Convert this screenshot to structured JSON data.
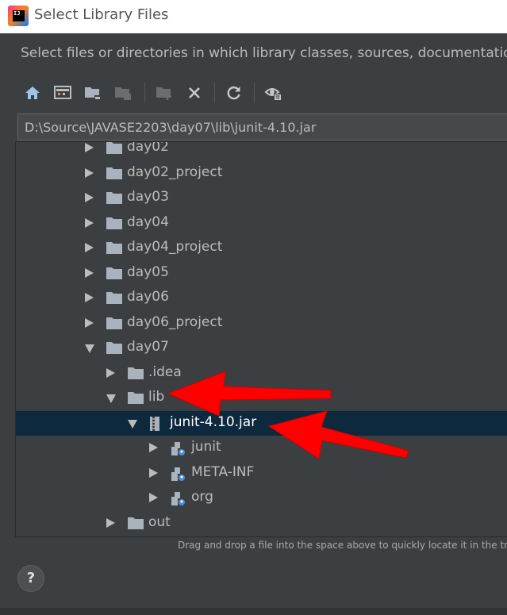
{
  "window": {
    "title": "Select Library Files",
    "logo_text": "IJ"
  },
  "description": "Select files or directories in which library classes, sources, documentation or native libraries are located",
  "toolbar": {
    "buttons": [
      {
        "name": "home-button",
        "icon": "home-icon"
      },
      {
        "name": "desktop-button",
        "icon": "desktop-icon"
      },
      {
        "name": "project-button",
        "icon": "project-folder-icon"
      },
      {
        "name": "module-button",
        "icon": "module-folder-icon"
      },
      {
        "name": "new-folder-button",
        "icon": "new-folder-icon"
      },
      {
        "name": "delete-button",
        "icon": "close-icon"
      },
      {
        "name": "refresh-button",
        "icon": "refresh-icon"
      },
      {
        "name": "show-hidden-button",
        "icon": "show-hidden-icon"
      }
    ]
  },
  "path": "D:\\Source\\JAVASE2203\\day07\\lib\\junit-4.10.jar",
  "tree": {
    "rows": [
      {
        "label": "day02",
        "level": 0,
        "expander": "right",
        "icon": "folder"
      },
      {
        "label": "day02_project",
        "level": 0,
        "expander": "right",
        "icon": "folder"
      },
      {
        "label": "day03",
        "level": 0,
        "expander": "right",
        "icon": "folder"
      },
      {
        "label": "day04",
        "level": 0,
        "expander": "right",
        "icon": "folder"
      },
      {
        "label": "day04_project",
        "level": 0,
        "expander": "right",
        "icon": "folder"
      },
      {
        "label": "day05",
        "level": 0,
        "expander": "right",
        "icon": "folder"
      },
      {
        "label": "day06",
        "level": 0,
        "expander": "right",
        "icon": "folder"
      },
      {
        "label": "day06_project",
        "level": 0,
        "expander": "right",
        "icon": "folder"
      },
      {
        "label": "day07",
        "level": 0,
        "expander": "down",
        "icon": "folder"
      },
      {
        "label": ".idea",
        "level": 1,
        "expander": "right",
        "icon": "folder"
      },
      {
        "label": "lib",
        "level": 1,
        "expander": "down",
        "icon": "folder"
      },
      {
        "label": "junit-4.10.jar",
        "level": 2,
        "expander": "down",
        "icon": "jar",
        "selected": true
      },
      {
        "label": "junit",
        "level": 3,
        "expander": "right",
        "icon": "package"
      },
      {
        "label": "META-INF",
        "level": 3,
        "expander": "right",
        "icon": "package"
      },
      {
        "label": "org",
        "level": 3,
        "expander": "right",
        "icon": "package"
      },
      {
        "label": "out",
        "level": 1,
        "expander": "right",
        "icon": "folder"
      }
    ]
  },
  "hint": "Drag and drop a file into the space above to quickly locate it in the tree",
  "help": {
    "label": "?"
  },
  "colors": {
    "background": "#3c3f41",
    "selection": "#0d293e",
    "annotation_arrow": "#ff0000",
    "text": "#bbbbbb"
  }
}
